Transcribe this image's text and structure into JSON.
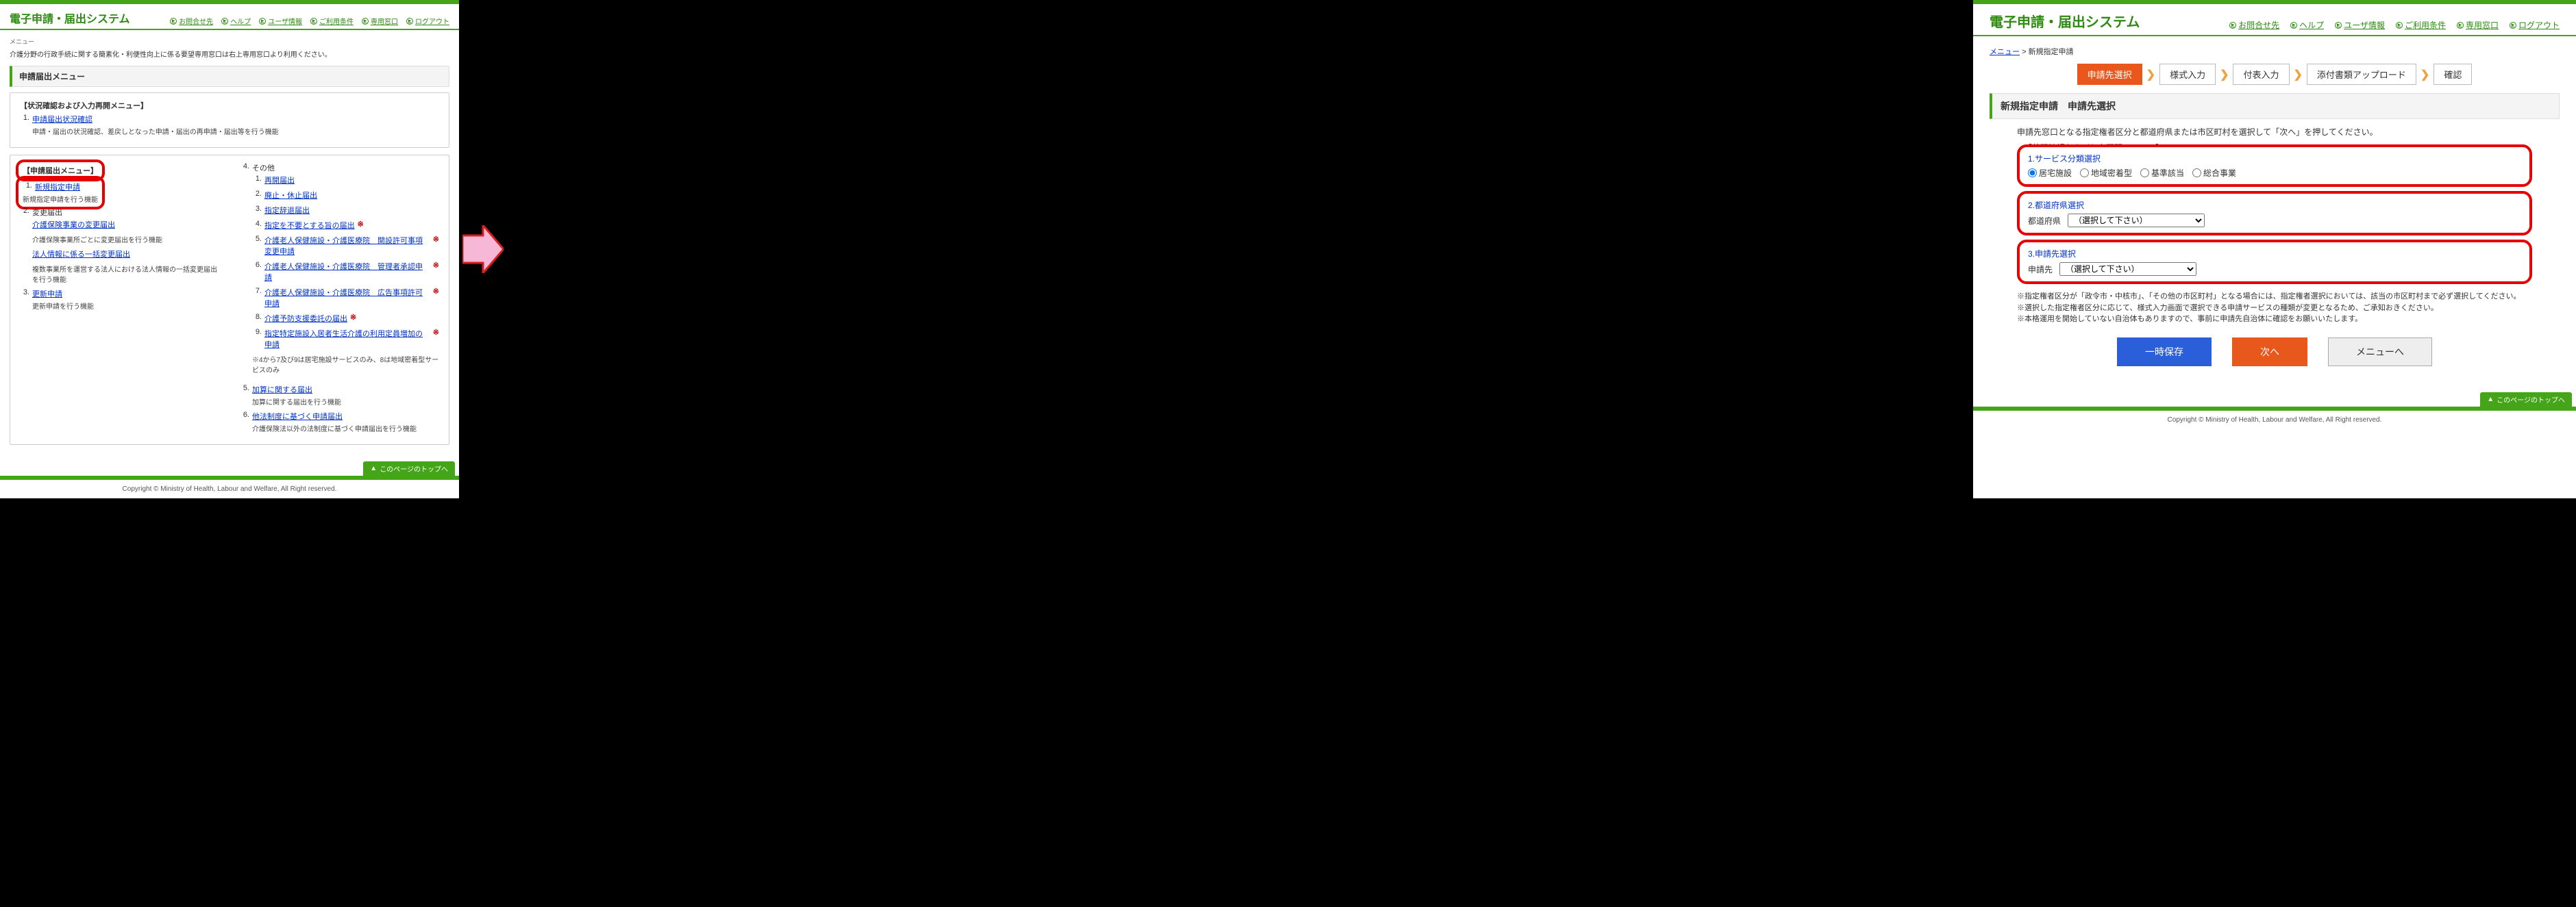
{
  "system_title": "電子申請・届出システム",
  "header_links": [
    "お問合せ先",
    "ヘルプ",
    "ユーザ情報",
    "ご利用条件",
    "専用窓口",
    "ログアウト"
  ],
  "to_top": "このページのトップへ",
  "copyright": "Copyright © Ministry of Health, Labour and Welfare, All Right reserved.",
  "left": {
    "menu_label": "メニュー",
    "intro": "介護分野の行政手続に関する簡素化・利便性向上に係る要望専用窓口は右上専用窓口より利用ください。",
    "section_title": "申請届出メニュー",
    "status_panel": {
      "title": "【状況確認および入力再開メニュー】",
      "link": "申請届出状況確認",
      "desc": "申請・届出の状況確認、差戻しとなった申請・届出の再申請・届出等を行う機能"
    },
    "app_panel": {
      "title": "【申請届出メニュー】",
      "col1": [
        {
          "n": "1.",
          "link": "新規指定申請",
          "desc": "新規指定申請を行う機能",
          "highlight": true
        },
        {
          "n": "2.",
          "text": "変更届出",
          "sub": [
            {
              "link": "介護保険事業の変更届出",
              "desc": "介護保険事業所ごとに変更届出を行う機能"
            },
            {
              "link": "法人情報に係る一括変更届出",
              "desc": "複数事業所を運営する法人における法人情報の一括変更届出を行う機能"
            }
          ]
        },
        {
          "n": "3.",
          "link": "更新申請",
          "desc": "更新申請を行う機能"
        }
      ],
      "col2_head": {
        "n": "4.",
        "text": "その他"
      },
      "col2_items": [
        {
          "n": "1.",
          "link": "再開届出"
        },
        {
          "n": "2.",
          "link": "廃止・休止届出"
        },
        {
          "n": "3.",
          "link": "指定辞退届出"
        },
        {
          "n": "4.",
          "link": "指定を不要とする旨の届出",
          "star": true
        },
        {
          "n": "5.",
          "link": "介護老人保健施設・介護医療院　開設許可事項変更申請",
          "star": true
        },
        {
          "n": "6.",
          "link": "介護老人保健施設・介護医療院　管理者承認申請",
          "star": true
        },
        {
          "n": "7.",
          "link": "介護老人保健施設・介護医療院　広告事項許可申請",
          "star": true
        },
        {
          "n": "8.",
          "link": "介護予防支援委託の届出",
          "star": true
        },
        {
          "n": "9.",
          "link": "指定特定施設入居者生活介護の利用定員増加の申請",
          "star": true
        }
      ],
      "col2_note": "※4から7及び9は居宅施設サービスのみ、8は地域密着型サービスのみ",
      "col2_extra": [
        {
          "n": "5.",
          "link": "加算に関する届出",
          "desc": "加算に関する届出を行う機能"
        },
        {
          "n": "6.",
          "link": "他法制度に基づく申請届出",
          "desc": "介護保険法以外の法制度に基づく申請届出を行う機能"
        }
      ]
    }
  },
  "right": {
    "breadcrumb": {
      "menu": "メニュー",
      "sep": ">",
      "current": "新規指定申請"
    },
    "steps": [
      "申請先選択",
      "様式入力",
      "付表入力",
      "添付書類アップロード",
      "確認"
    ],
    "active_step": 0,
    "section_title": "新規指定申請　申請先選択",
    "instruction": "申請先窓口となる指定権者区分と都道府県または市区町村を選択して「次へ」を押してください。",
    "hidden_title": "【状況確認および入力再開メニュー】",
    "form": {
      "sec1": {
        "title": "1.サービス分類選択",
        "options": [
          "居宅施設",
          "地域密着型",
          "基準該当",
          "総合事業"
        ],
        "selected": 0
      },
      "sec2": {
        "title": "2.都道府県選択",
        "label": "都道府県",
        "placeholder": "（選択して下さい）"
      },
      "sec3": {
        "title": "3.申請先選択",
        "label": "申請先",
        "placeholder": "（選択して下さい）"
      }
    },
    "notes": [
      "※指定権者区分が「政令市・中核市」、「その他の市区町村」となる場合には、指定権者選択においては、該当の市区町村まで必ず選択してください。",
      "※選択した指定権者区分に応じて、様式入力画面で選択できる申請サービスの種類が変更となるため、ご承知おきください。",
      "※本格運用を開始していない自治体もありますので、事前に申請先自治体に確認をお願いいたします。"
    ],
    "buttons": {
      "save": "一時保存",
      "next": "次へ",
      "menu": "メニューへ"
    }
  }
}
